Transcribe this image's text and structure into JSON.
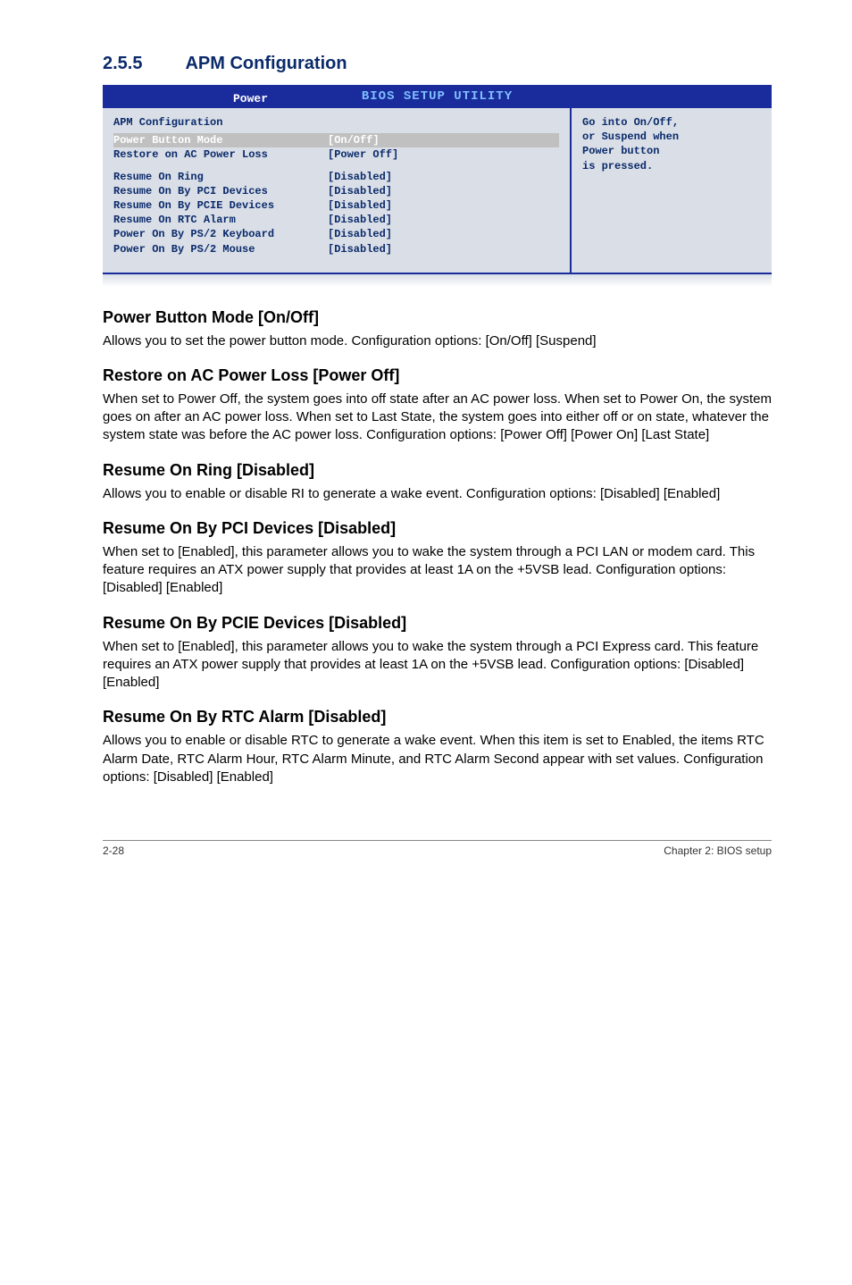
{
  "section": {
    "number": "2.5.5",
    "title": "APM Configuration"
  },
  "bios": {
    "header_title": "BIOS SETUP UTILITY",
    "tab": "Power",
    "left": {
      "group_title": "APM Configuration",
      "rows_top": [
        {
          "label": "Power Button Mode",
          "value": "[On/Off]",
          "highlight": true
        },
        {
          "label": "Restore on AC Power Loss",
          "value": "[Power Off]"
        }
      ],
      "rows_bottom": [
        {
          "label": "Resume On Ring",
          "value": "[Disabled]"
        },
        {
          "label": "Resume On By PCI Devices",
          "value": "[Disabled]"
        },
        {
          "label": "Resume On By PCIE Devices",
          "value": "[Disabled]"
        },
        {
          "label": "Resume On RTC Alarm",
          "value": "[Disabled]"
        },
        {
          "label": "Power On By PS/2 Keyboard",
          "value": "[Disabled]"
        },
        {
          "label": "Power On By PS/2 Mouse",
          "value": "[Disabled]"
        }
      ]
    },
    "right": [
      "Go into On/Off,",
      "or Suspend when",
      "Power button",
      "is pressed."
    ]
  },
  "subs": [
    {
      "heading": "Power Button Mode [On/Off]",
      "body": "Allows you to set the power button mode. Configuration options: [On/Off] [Suspend]"
    },
    {
      "heading": "Restore on AC Power Loss [Power Off]",
      "body": "When set to Power Off, the system goes into off state after an AC power loss. When set to Power On, the system goes on after an AC power loss. When set to Last State, the system goes into either off or on state, whatever the system state was before the AC power loss. Configuration options: [Power Off] [Power On] [Last State]"
    },
    {
      "heading": "Resume On Ring [Disabled]",
      "body": "Allows you to enable or disable RI to generate a wake event. Configuration options: [Disabled] [Enabled]"
    },
    {
      "heading": "Resume On By PCI Devices [Disabled]",
      "body": "When set to [Enabled], this parameter allows you to wake the system through a PCI LAN or modem card. This feature requires an ATX power supply that provides at least 1A on the +5VSB lead. Configuration options: [Disabled] [Enabled]"
    },
    {
      "heading": "Resume On By PCIE Devices [Disabled]",
      "body": "When set to [Enabled], this parameter allows you to wake the system through a PCI Express card. This feature requires an ATX power supply that provides at least 1A on the +5VSB lead.  Configuration options: [Disabled] [Enabled]"
    },
    {
      "heading": "Resume On By RTC Alarm [Disabled]",
      "body": "Allows you to enable or disable RTC to generate a wake event. When this item is set to Enabled, the items RTC Alarm Date, RTC Alarm Hour, RTC Alarm Minute, and RTC Alarm Second appear with set values. Configuration options: [Disabled] [Enabled]"
    }
  ],
  "footer": {
    "left": "2-28",
    "right": "Chapter 2: BIOS setup"
  }
}
